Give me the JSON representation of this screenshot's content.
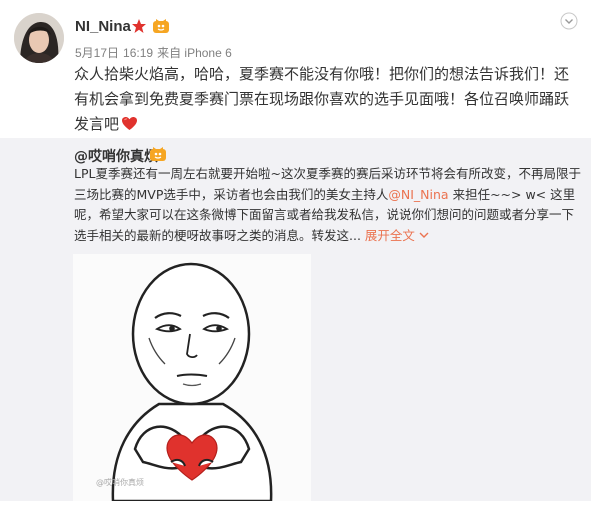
{
  "post": {
    "username": "NI_Nina",
    "date": "5月17日",
    "time": "16:19",
    "source": "来自 iPhone 6",
    "text": "众人拾柴火焰高，哈哈，夏季赛不能没有你哦！把你们的想法告诉我们！还有机会拿到免费夏季赛门票在现场跟你喜欢的选手见面哦！各位召唤师踊跃发言吧",
    "trailing_emoji": [
      "heart-emoji",
      "heart-emoji",
      "heart-emoji"
    ]
  },
  "repost": {
    "author": "@哎哨你真烦",
    "text_part1": "LPL夏季赛还有一周左右就要开始啦~这次夏季赛的赛后采访环节将会有所改变，不再局限于三场比赛的MVP选手中，采访者也会由我们的美女主持人",
    "mention": "@NI_Nina",
    "text_part2": "来担任~~> w< 这里呢，希望大家可以在这条微博下面留言或者给我发私信，说说你们想问的问题或者分享一下选手相关的最新的梗呀故事呀之类的消息。转发这...",
    "expand_label": "展开全文",
    "image_watermark": "@哎哨你真烦"
  },
  "colors": {
    "accent": "#eb7350",
    "repost_bg": "#f2f2f5",
    "heart": "#e0322d"
  },
  "icons": {
    "star": "star-badge-icon",
    "vip": "vip-badge-icon",
    "menu": "chevron-down-icon",
    "heart": "heart-emoji"
  }
}
